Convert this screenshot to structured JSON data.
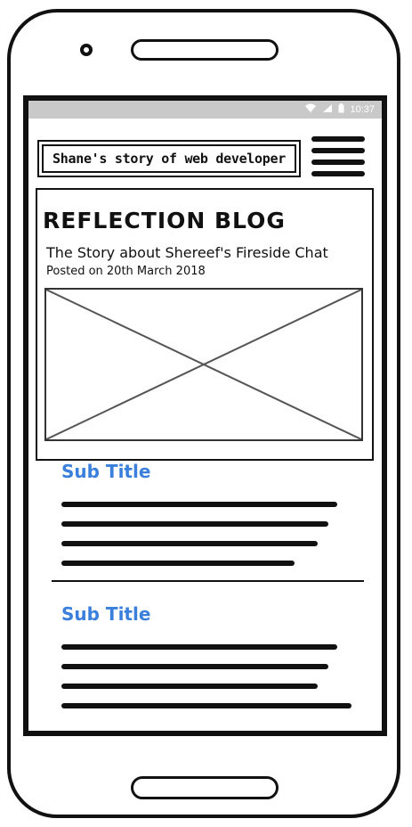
{
  "status_bar": {
    "time": "10:37",
    "icons": [
      "wifi-icon",
      "signal-icon",
      "battery-icon"
    ]
  },
  "header": {
    "title": "Shane's story of web developer"
  },
  "post": {
    "blog_title": "REFLECTION BLOG",
    "story_title": "The Story about Shereef's Fireside Chat",
    "posted": "Posted on 20th March 2018"
  },
  "sections": [
    {
      "subtitle": "Sub Title"
    },
    {
      "subtitle": "Sub Title"
    }
  ],
  "colors": {
    "accent": "#3a7fdc",
    "status_bar": "#c9c9c9",
    "ink": "#111111"
  }
}
